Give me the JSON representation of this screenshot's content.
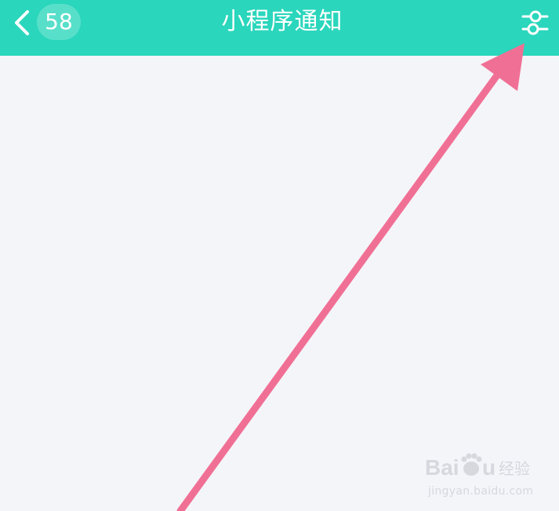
{
  "header": {
    "back_count": "58",
    "title": "小程序通知"
  },
  "icons": {
    "back": "chevron-left-icon",
    "settings": "sliders-icon",
    "annotation": "pink-arrow-pointing-to-settings"
  },
  "watermark": {
    "logo_text": "Baidu经验",
    "url": "jingyan.baidu.com"
  },
  "colors": {
    "header_bg": "#2ad6bc",
    "page_bg": "#f4f5f9",
    "arrow": "#f07095",
    "text": "#ffffff"
  }
}
